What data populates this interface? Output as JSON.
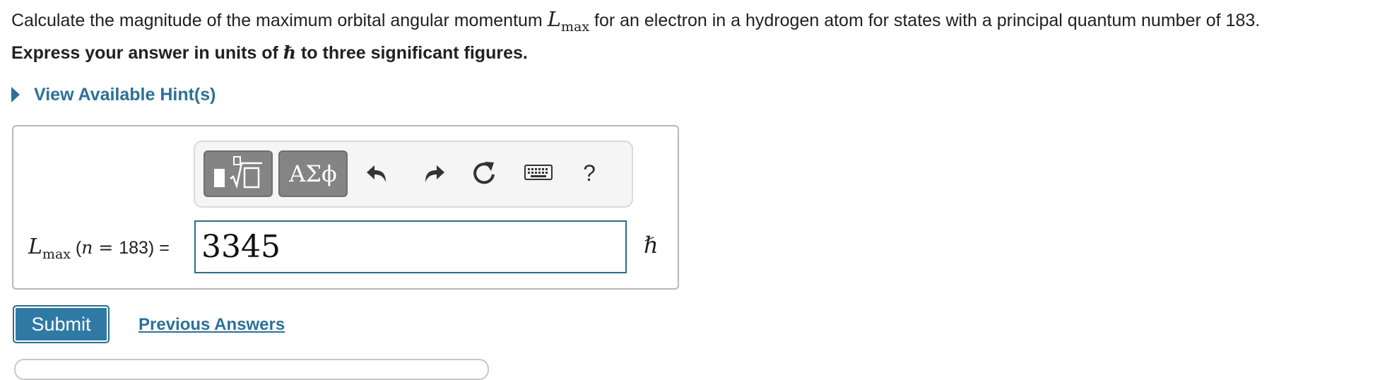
{
  "question": {
    "text_before": "Calculate the magnitude of the maximum orbital angular momentum ",
    "symbol": "L",
    "subscript": "max",
    "text_after": " for an electron in a hydrogen atom for states with a principal quantum number of 183."
  },
  "instruction": {
    "text_before": "Express your answer in units of ",
    "unit_symbol": "ℏ",
    "text_after": " to three significant figures."
  },
  "hint": {
    "label": "View Available Hint(s)"
  },
  "toolbar": {
    "greek_label": "ΑΣϕ",
    "help_label": "?",
    "icons": [
      "templates-icon",
      "greek-letters-icon",
      "undo-icon",
      "redo-icon",
      "reset-icon",
      "keyboard-icon",
      "help-icon"
    ]
  },
  "answer": {
    "label_symbol": "L",
    "label_subscript": "max",
    "label_open": " (",
    "label_n": "n",
    "label_eq": " = ",
    "label_value": "183) =",
    "input_value": "3345",
    "unit": "ℏ"
  },
  "actions": {
    "submit_label": "Submit",
    "previous_answers_label": "Previous Answers"
  },
  "colors": {
    "link": "#2c7198",
    "submit_bg": "#2f7aa5",
    "toolbar_button": "#848484",
    "input_border": "#2c6d8e"
  }
}
